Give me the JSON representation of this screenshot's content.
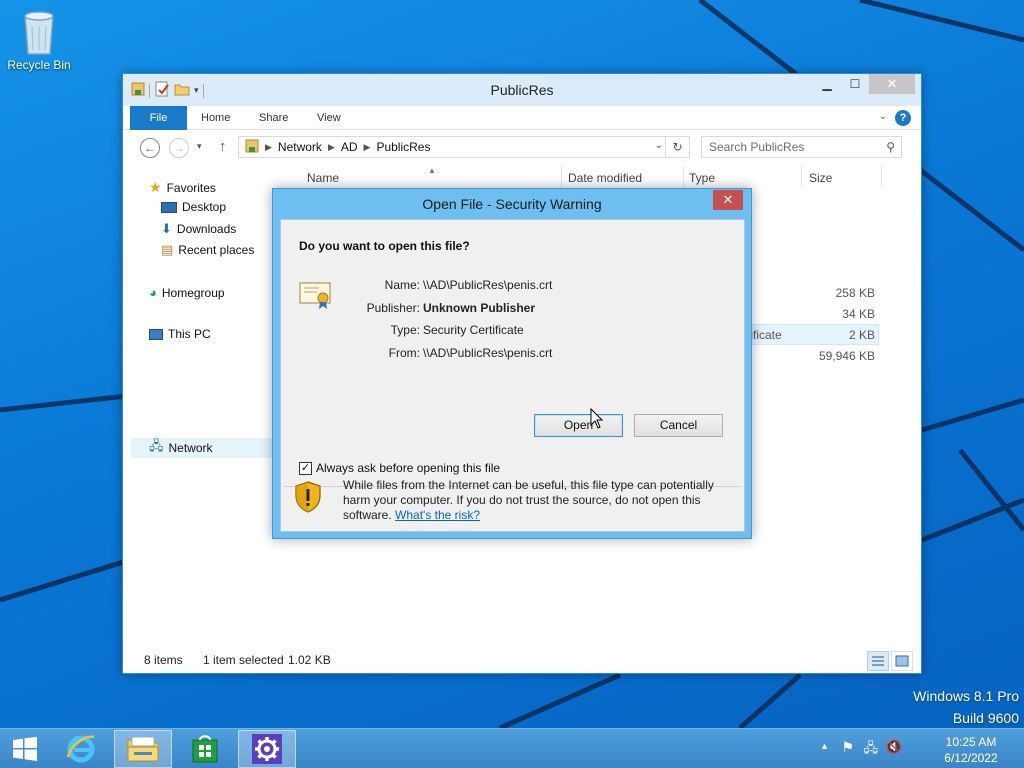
{
  "desktop": {
    "recycle_bin_label": "Recycle Bin",
    "os_name": "Windows 8.1 Pro",
    "build": "Build 9600"
  },
  "explorer": {
    "title": "PublicRes",
    "ribbon_tabs": [
      "File",
      "Home",
      "Share",
      "View"
    ],
    "help_label": "?",
    "address": {
      "segments": [
        "Network",
        "AD",
        "PublicRes"
      ]
    },
    "search_placeholder": "Search PublicRes",
    "nav": {
      "favorites": "Favorites",
      "desktop": "Desktop",
      "downloads": "Downloads",
      "recent": "Recent places",
      "homegroup": "Homegroup",
      "this_pc": "This PC",
      "network": "Network"
    },
    "columns": {
      "name": "Name",
      "date": "Date modified",
      "type": "Type",
      "size": "Size"
    },
    "rows": [
      {
        "type": "",
        "size": "258 KB"
      },
      {
        "type": "",
        "size": "34 KB"
      },
      {
        "type": "tificate",
        "size": "2 KB"
      },
      {
        "type": "",
        "size": "59,946 KB"
      }
    ],
    "status": {
      "items": "8 items",
      "selected": "1 item selected",
      "selected_size": "1.02 KB"
    }
  },
  "dialog": {
    "title": "Open File - Security Warning",
    "close_label": "✕",
    "question": "Do you want to open this file?",
    "fields": {
      "name_label": "Name:",
      "name_value": "\\\\AD\\PublicRes\\penis.crt",
      "publisher_label": "Publisher:",
      "publisher_value": "Unknown Publisher",
      "type_label": "Type:",
      "type_value": "Security Certificate",
      "from_label": "From:",
      "from_value": "\\\\AD\\PublicRes\\penis.crt"
    },
    "open_button": "Open",
    "cancel_button": "Cancel",
    "checkbox_label": "Always ask before opening this file",
    "checkbox_checked": true,
    "warning_text": "While files from the Internet can be useful, this file type can potentially harm your computer. If you do not trust the source, do not open this software.",
    "risk_link": "What's the risk?"
  },
  "taskbar": {
    "time": "10:25 AM",
    "date": "6/12/2022"
  },
  "colors": {
    "accent": "#1979ca",
    "dialog_frame": "#6cbff0",
    "close_red": "#c75050"
  }
}
